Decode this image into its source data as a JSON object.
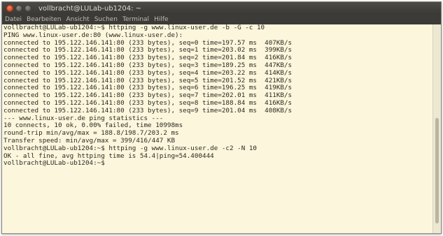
{
  "window": {
    "title": "vollbracht@LULab-ub1204: ~",
    "controls": [
      "close-icon",
      "minimize-icon",
      "maximize-icon"
    ]
  },
  "menu": {
    "items": [
      "Datei",
      "Bearbeiten",
      "Ansicht",
      "Suchen",
      "Terminal",
      "Hilfe"
    ]
  },
  "terminal": {
    "background": "#fbf6dc",
    "lines": [
      "vollbracht@LULab-ub1204:~$ httping -g www.linux-user.de -b -G -c 10",
      "PING www.linux-user.de:80 (www.linux-user.de):",
      "connected to 195.122.146.141:80 (233 bytes), seq=0 time=197.57 ms  407KB/s",
      "connected to 195.122.146.141:80 (233 bytes), seq=1 time=203.02 ms  399KB/s",
      "connected to 195.122.146.141:80 (233 bytes), seq=2 time=201.84 ms  416KB/s",
      "connected to 195.122.146.141:80 (233 bytes), seq=3 time=189.25 ms  447KB/s",
      "connected to 195.122.146.141:80 (233 bytes), seq=4 time=203.22 ms  414KB/s",
      "connected to 195.122.146.141:80 (233 bytes), seq=5 time=201.52 ms  421KB/s",
      "connected to 195.122.146.141:80 (233 bytes), seq=6 time=196.25 ms  419KB/s",
      "connected to 195.122.146.141:80 (233 bytes), seq=7 time=202.01 ms  411KB/s",
      "connected to 195.122.146.141:80 (233 bytes), seq=8 time=188.84 ms  416KB/s",
      "connected to 195.122.146.141:80 (233 bytes), seq=9 time=201.04 ms  408KB/s",
      "--- www.linux-user.de ping statistics ---",
      "10 connects, 10 ok, 0.00% failed, time 10998ms",
      "round-trip min/avg/max = 188.8/198.7/203.2 ms",
      "Transfer speed: min/avg/max = 399/416/447 KB",
      "vollbracht@LULab-ub1204:~$ httping -g www.linux-user.de -c2 -N 10",
      "OK - all fine, avg httping time is 54.4|ping=54.400444",
      "vollbracht@LULab-ub1204:~$ "
    ]
  }
}
